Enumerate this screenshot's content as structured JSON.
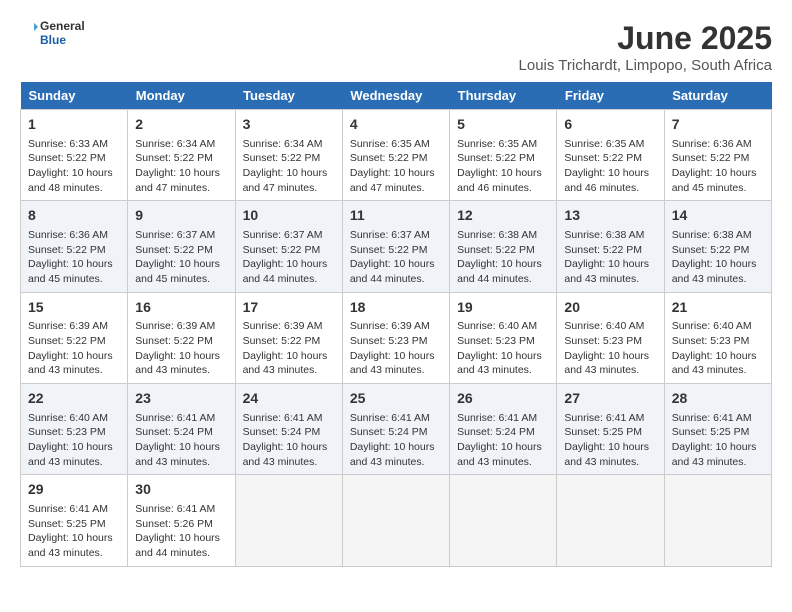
{
  "logo": {
    "line1": "General",
    "line2": "Blue"
  },
  "title": "June 2025",
  "subtitle": "Louis Trichardt, Limpopo, South Africa",
  "headers": [
    "Sunday",
    "Monday",
    "Tuesday",
    "Wednesday",
    "Thursday",
    "Friday",
    "Saturday"
  ],
  "weeks": [
    [
      {
        "day": "1",
        "info": "Sunrise: 6:33 AM\nSunset: 5:22 PM\nDaylight: 10 hours\nand 48 minutes."
      },
      {
        "day": "2",
        "info": "Sunrise: 6:34 AM\nSunset: 5:22 PM\nDaylight: 10 hours\nand 47 minutes."
      },
      {
        "day": "3",
        "info": "Sunrise: 6:34 AM\nSunset: 5:22 PM\nDaylight: 10 hours\nand 47 minutes."
      },
      {
        "day": "4",
        "info": "Sunrise: 6:35 AM\nSunset: 5:22 PM\nDaylight: 10 hours\nand 47 minutes."
      },
      {
        "day": "5",
        "info": "Sunrise: 6:35 AM\nSunset: 5:22 PM\nDaylight: 10 hours\nand 46 minutes."
      },
      {
        "day": "6",
        "info": "Sunrise: 6:35 AM\nSunset: 5:22 PM\nDaylight: 10 hours\nand 46 minutes."
      },
      {
        "day": "7",
        "info": "Sunrise: 6:36 AM\nSunset: 5:22 PM\nDaylight: 10 hours\nand 45 minutes."
      }
    ],
    [
      {
        "day": "8",
        "info": "Sunrise: 6:36 AM\nSunset: 5:22 PM\nDaylight: 10 hours\nand 45 minutes."
      },
      {
        "day": "9",
        "info": "Sunrise: 6:37 AM\nSunset: 5:22 PM\nDaylight: 10 hours\nand 45 minutes."
      },
      {
        "day": "10",
        "info": "Sunrise: 6:37 AM\nSunset: 5:22 PM\nDaylight: 10 hours\nand 44 minutes."
      },
      {
        "day": "11",
        "info": "Sunrise: 6:37 AM\nSunset: 5:22 PM\nDaylight: 10 hours\nand 44 minutes."
      },
      {
        "day": "12",
        "info": "Sunrise: 6:38 AM\nSunset: 5:22 PM\nDaylight: 10 hours\nand 44 minutes."
      },
      {
        "day": "13",
        "info": "Sunrise: 6:38 AM\nSunset: 5:22 PM\nDaylight: 10 hours\nand 43 minutes."
      },
      {
        "day": "14",
        "info": "Sunrise: 6:38 AM\nSunset: 5:22 PM\nDaylight: 10 hours\nand 43 minutes."
      }
    ],
    [
      {
        "day": "15",
        "info": "Sunrise: 6:39 AM\nSunset: 5:22 PM\nDaylight: 10 hours\nand 43 minutes."
      },
      {
        "day": "16",
        "info": "Sunrise: 6:39 AM\nSunset: 5:22 PM\nDaylight: 10 hours\nand 43 minutes."
      },
      {
        "day": "17",
        "info": "Sunrise: 6:39 AM\nSunset: 5:22 PM\nDaylight: 10 hours\nand 43 minutes."
      },
      {
        "day": "18",
        "info": "Sunrise: 6:39 AM\nSunset: 5:23 PM\nDaylight: 10 hours\nand 43 minutes."
      },
      {
        "day": "19",
        "info": "Sunrise: 6:40 AM\nSunset: 5:23 PM\nDaylight: 10 hours\nand 43 minutes."
      },
      {
        "day": "20",
        "info": "Sunrise: 6:40 AM\nSunset: 5:23 PM\nDaylight: 10 hours\nand 43 minutes."
      },
      {
        "day": "21",
        "info": "Sunrise: 6:40 AM\nSunset: 5:23 PM\nDaylight: 10 hours\nand 43 minutes."
      }
    ],
    [
      {
        "day": "22",
        "info": "Sunrise: 6:40 AM\nSunset: 5:23 PM\nDaylight: 10 hours\nand 43 minutes."
      },
      {
        "day": "23",
        "info": "Sunrise: 6:41 AM\nSunset: 5:24 PM\nDaylight: 10 hours\nand 43 minutes."
      },
      {
        "day": "24",
        "info": "Sunrise: 6:41 AM\nSunset: 5:24 PM\nDaylight: 10 hours\nand 43 minutes."
      },
      {
        "day": "25",
        "info": "Sunrise: 6:41 AM\nSunset: 5:24 PM\nDaylight: 10 hours\nand 43 minutes."
      },
      {
        "day": "26",
        "info": "Sunrise: 6:41 AM\nSunset: 5:24 PM\nDaylight: 10 hours\nand 43 minutes."
      },
      {
        "day": "27",
        "info": "Sunrise: 6:41 AM\nSunset: 5:25 PM\nDaylight: 10 hours\nand 43 minutes."
      },
      {
        "day": "28",
        "info": "Sunrise: 6:41 AM\nSunset: 5:25 PM\nDaylight: 10 hours\nand 43 minutes."
      }
    ],
    [
      {
        "day": "29",
        "info": "Sunrise: 6:41 AM\nSunset: 5:25 PM\nDaylight: 10 hours\nand 43 minutes."
      },
      {
        "day": "30",
        "info": "Sunrise: 6:41 AM\nSunset: 5:26 PM\nDaylight: 10 hours\nand 44 minutes."
      },
      {
        "day": "",
        "info": ""
      },
      {
        "day": "",
        "info": ""
      },
      {
        "day": "",
        "info": ""
      },
      {
        "day": "",
        "info": ""
      },
      {
        "day": "",
        "info": ""
      }
    ]
  ]
}
